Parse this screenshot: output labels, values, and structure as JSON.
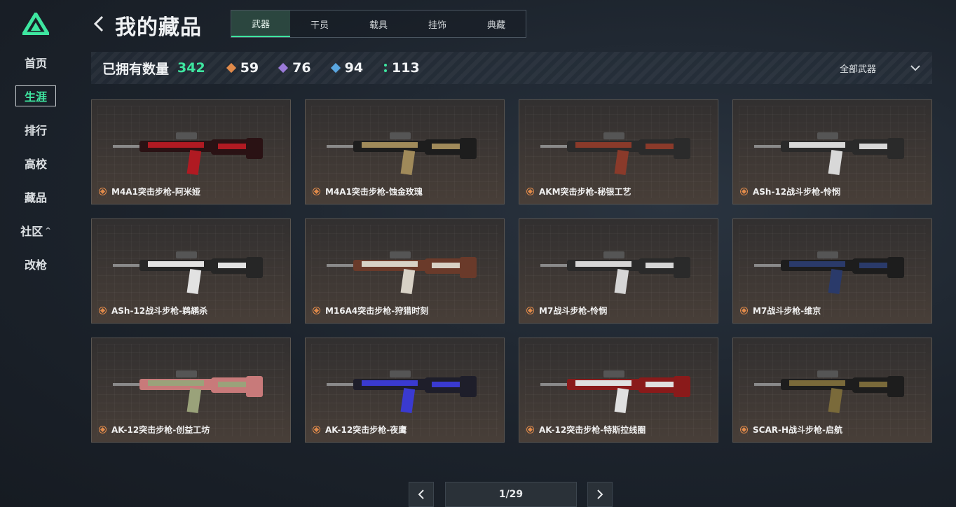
{
  "sidebar": {
    "items": [
      {
        "label": "首页",
        "active": false
      },
      {
        "label": "生涯",
        "active": true
      },
      {
        "label": "排行",
        "active": false
      },
      {
        "label": "高校",
        "active": false
      },
      {
        "label": "藏品",
        "active": false
      },
      {
        "label": "社区",
        "active": false,
        "caret": "^"
      },
      {
        "label": "改枪",
        "active": false
      }
    ]
  },
  "header": {
    "title": "我的藏品",
    "tabs": [
      {
        "label": "武器",
        "active": true
      },
      {
        "label": "干员",
        "active": false
      },
      {
        "label": "载具",
        "active": false
      },
      {
        "label": "挂饰",
        "active": false
      },
      {
        "label": "典藏",
        "active": false
      }
    ]
  },
  "stats": {
    "owned_label": "已拥有数量",
    "owned_count": "342",
    "rarity_counts": [
      {
        "value": "59",
        "color": "#e08a4a",
        "icon": "orange-diamond-icon"
      },
      {
        "value": "76",
        "color": "#9a7ad8",
        "icon": "purple-diamond-icon"
      },
      {
        "value": "94",
        "color": "#5aa6e0",
        "icon": "blue-diamond-icon"
      },
      {
        "value": "113",
        "color": "#3ee6a0",
        "icon": "green-dots-icon"
      }
    ],
    "filter_label": "全部武器"
  },
  "items": [
    {
      "name": "M4A1突击步枪-阿米娅",
      "accent": "#b01a22",
      "body": "#2a1214"
    },
    {
      "name": "M4A1突击步枪-蚀金玫瑰",
      "accent": "#a08a5a",
      "body": "#1d1d1d"
    },
    {
      "name": "AKM突击步枪-秘银工艺",
      "accent": "#8a3a2a",
      "body": "#2b2b2b"
    },
    {
      "name": "ASh-12战斗步枪-怜悯",
      "accent": "#d8d8d8",
      "body": "#2a2a2a"
    },
    {
      "name": "ASh-12战斗步枪-鹈鹕杀",
      "accent": "#e2e2e2",
      "body": "#262626"
    },
    {
      "name": "M16A4突击步枪-狩猎时刻",
      "accent": "#d8d2c6",
      "body": "#6a3a2a"
    },
    {
      "name": "M7战斗步枪-怜悯",
      "accent": "#d6d6d6",
      "body": "#2a2a2a"
    },
    {
      "name": "M7战斗步枪-维京",
      "accent": "#2a3a6a",
      "body": "#1d1d1d"
    },
    {
      "name": "AK-12突击步枪-创益工坊",
      "accent": "#9aa27a",
      "body": "#c87a7a"
    },
    {
      "name": "AK-12突击步枪-夜鹰",
      "accent": "#3a3ad0",
      "body": "#1e1e2a"
    },
    {
      "name": "AK-12突击步枪-特斯拉线圈",
      "accent": "#e0e0e0",
      "body": "#8a1a1a"
    },
    {
      "name": "SCAR-H战斗步枪-启航",
      "accent": "#7a6a3a",
      "body": "#1d1d1d"
    }
  ],
  "pagination": {
    "indicator": "1/29"
  }
}
